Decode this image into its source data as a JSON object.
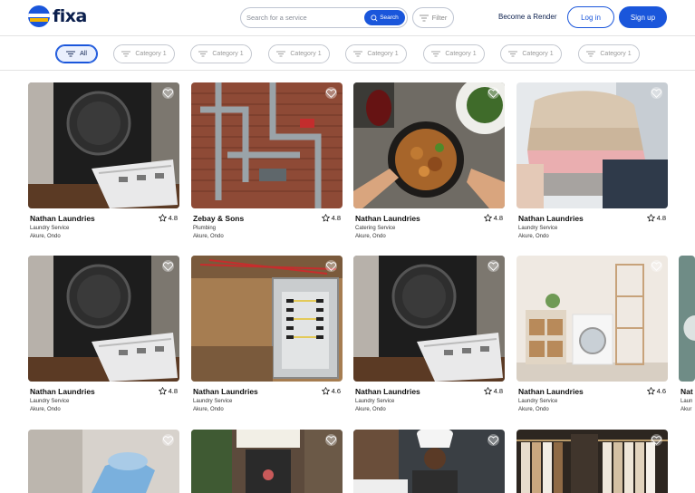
{
  "brand": {
    "name": "fixa",
    "colors": {
      "primary": "#1a56db",
      "accent": "#f5b400",
      "dark": "#0b1f4d"
    }
  },
  "header": {
    "search_placeholder": "Search for a service",
    "search_button": "Search",
    "filter_button": "Filter",
    "become_link": "Become a Render",
    "login_button": "Log in",
    "signup_button": "Sign up"
  },
  "categories": [
    "All",
    "Category 1",
    "Category 1",
    "Category 1",
    "Category 1",
    "Category 1",
    "Category 1",
    "Category 1"
  ],
  "cards": [
    {
      "name": "Nathan Laundries",
      "rating": "4.8",
      "category": "Laundry Service",
      "location": "Akure, Ondo",
      "image": "washing-machine"
    },
    {
      "name": "Zebay & Sons",
      "rating": "4.8",
      "category": "Plumbing",
      "location": "Akure, Ondo",
      "image": "pipes"
    },
    {
      "name": "Nathan Laundries",
      "rating": "4.8",
      "category": "Catering Service",
      "location": "Akure, Ondo",
      "image": "food"
    },
    {
      "name": "Nathan Laundries",
      "rating": "4.8",
      "category": "Laundry Service",
      "location": "Akure, Ondo",
      "image": "folded-clothes"
    },
    {
      "name": "Nathan Laundries",
      "rating": "4.8",
      "category": "Laundry Service",
      "location": "Akure, Ondo",
      "image": "washing-machine"
    },
    {
      "name": "Nathan Laundries",
      "rating": "4.6",
      "category": "Laundry Service",
      "location": "Akure, Ondo",
      "image": "electrical-panel"
    },
    {
      "name": "Nathan Laundries",
      "rating": "4.8",
      "category": "Laundry Service",
      "location": "Akure, Ondo",
      "image": "washing-machine"
    },
    {
      "name": "Nathan Laundries",
      "rating": "4.6",
      "category": "Laundry Service",
      "location": "Akure, Ondo",
      "image": "laundry-room"
    },
    {
      "name": "Nat",
      "rating": "",
      "category": "Laun",
      "location": "Akur",
      "image": "partial"
    },
    {
      "name": "",
      "rating": "",
      "category": "",
      "location": "",
      "image": "cleaning"
    },
    {
      "name": "",
      "rating": "",
      "category": "",
      "location": "",
      "image": "storefront"
    },
    {
      "name": "",
      "rating": "",
      "category": "",
      "location": "",
      "image": "chef"
    },
    {
      "name": "",
      "rating": "",
      "category": "",
      "location": "",
      "image": "clothing-rack"
    }
  ]
}
